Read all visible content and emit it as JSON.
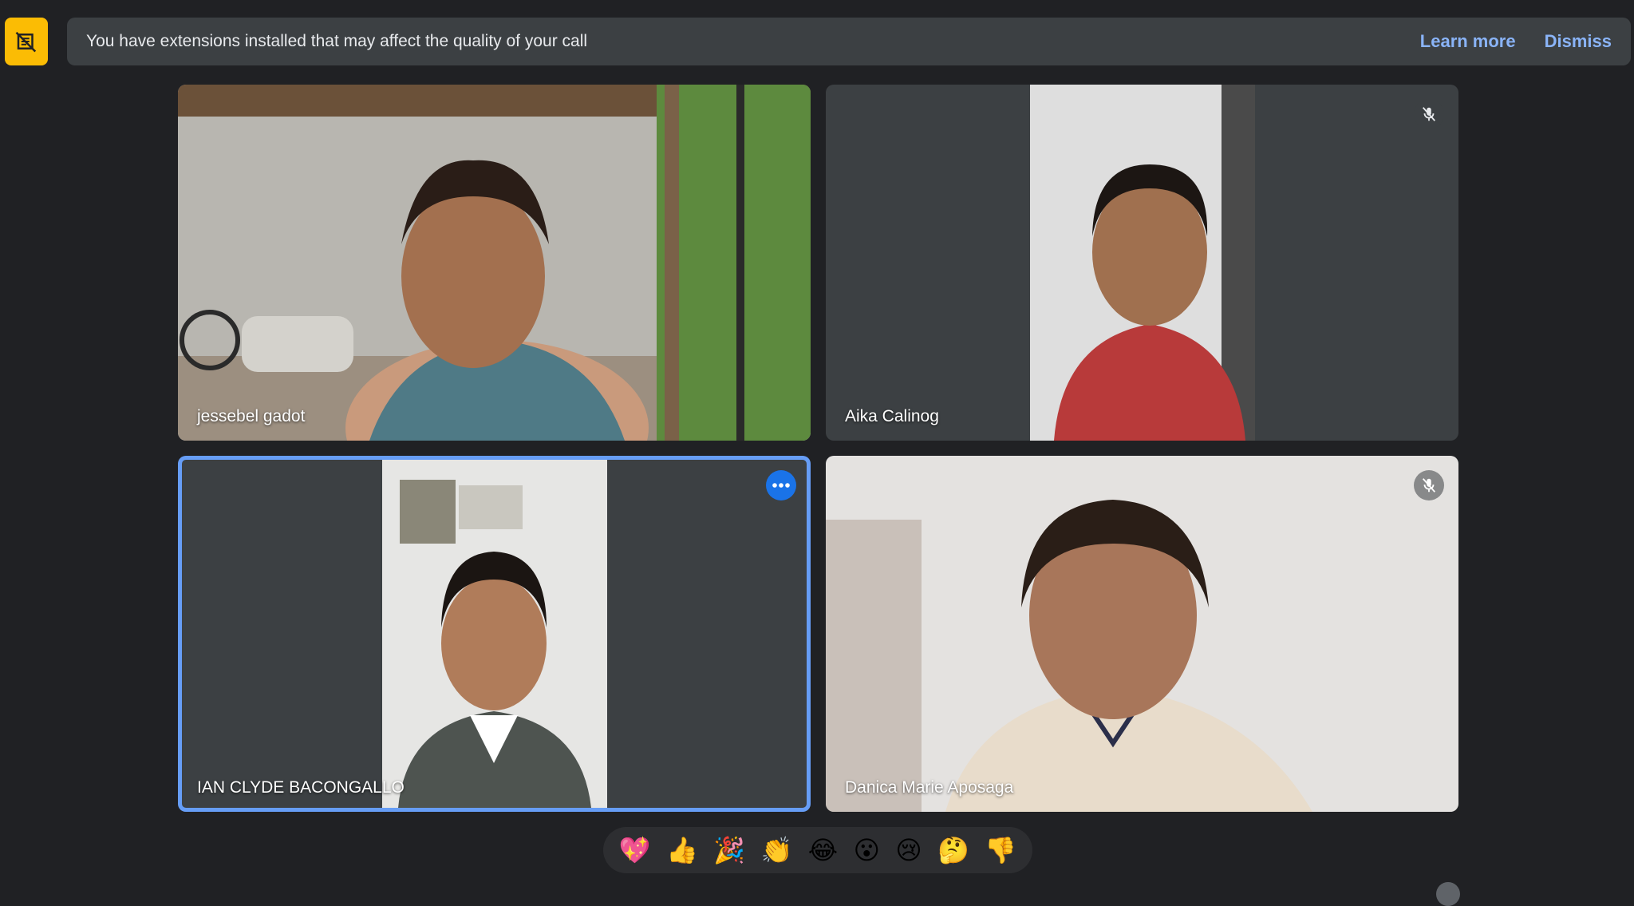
{
  "banner": {
    "message": "You have extensions installed that may affect the quality of your call",
    "learn_more": "Learn more",
    "dismiss": "Dismiss"
  },
  "participants": [
    {
      "name": "jessebel gadot",
      "muted": false
    },
    {
      "name": "Aika Calinog",
      "muted": true
    },
    {
      "name": "IAN CLYDE BACONGALLO",
      "muted": false,
      "active": true
    },
    {
      "name": "Danica Marie Aposaga",
      "muted": true
    }
  ],
  "reactions": [
    "💖",
    "👍",
    "🎉",
    "👏",
    "😂",
    "😮",
    "😢",
    "🤔",
    "👎"
  ],
  "colors": {
    "background": "#202124",
    "tile": "#3c4043",
    "accent": "#8ab4f8",
    "active_border": "#669df6",
    "warning": "#fbbc04"
  }
}
